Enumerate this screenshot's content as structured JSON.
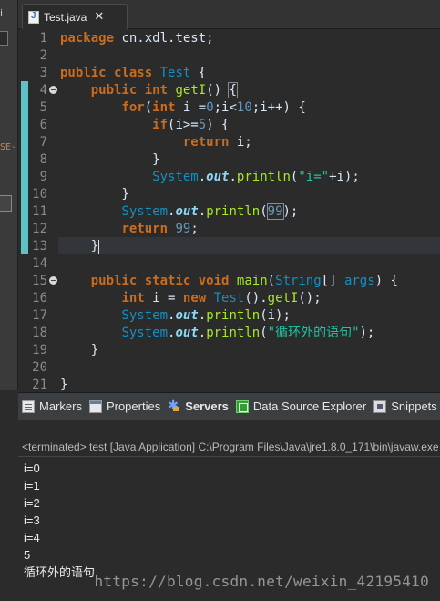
{
  "left_panel": {
    "title_fragment": "i",
    "fragment_text": "SE-"
  },
  "editor_tab": {
    "title": "Test.java",
    "icon": "java-file-icon",
    "close_icon": "close-icon"
  },
  "editor": {
    "line_numbers": [
      "1",
      "2",
      "3",
      "4",
      "5",
      "6",
      "7",
      "8",
      "9",
      "10",
      "11",
      "12",
      "13",
      "14",
      "15",
      "16",
      "17",
      "18",
      "19",
      "20",
      "21"
    ],
    "lines": [
      [
        {
          "t": "package",
          "c": "kw"
        },
        {
          "t": " cn.xdl.test;",
          "c": ""
        }
      ],
      [],
      [
        {
          "t": "public",
          "c": "kw"
        },
        {
          "t": " ",
          "c": ""
        },
        {
          "t": "class",
          "c": "kw"
        },
        {
          "t": " ",
          "c": ""
        },
        {
          "t": "Test",
          "c": "ty"
        },
        {
          "t": " {",
          "c": ""
        }
      ],
      [
        {
          "t": "    ",
          "c": ""
        },
        {
          "t": "public",
          "c": "kw"
        },
        {
          "t": " ",
          "c": ""
        },
        {
          "t": "int",
          "c": "kw"
        },
        {
          "t": " ",
          "c": ""
        },
        {
          "t": "getI",
          "c": "mt"
        },
        {
          "t": "() ",
          "c": ""
        },
        {
          "t": "{",
          "c": "brace-sel"
        }
      ],
      [
        {
          "t": "        ",
          "c": ""
        },
        {
          "t": "for",
          "c": "kw"
        },
        {
          "t": "(",
          "c": ""
        },
        {
          "t": "int",
          "c": "kw"
        },
        {
          "t": " i =",
          "c": ""
        },
        {
          "t": "0",
          "c": "nm"
        },
        {
          "t": ";i<",
          "c": ""
        },
        {
          "t": "10",
          "c": "nm"
        },
        {
          "t": ";i++) {",
          "c": ""
        }
      ],
      [
        {
          "t": "            ",
          "c": ""
        },
        {
          "t": "if",
          "c": "kw"
        },
        {
          "t": "(i>=",
          "c": ""
        },
        {
          "t": "5",
          "c": "nm"
        },
        {
          "t": ") {",
          "c": ""
        }
      ],
      [
        {
          "t": "                ",
          "c": ""
        },
        {
          "t": "return",
          "c": "kw"
        },
        {
          "t": " i;",
          "c": ""
        }
      ],
      [
        {
          "t": "            }",
          "c": ""
        }
      ],
      [
        {
          "t": "            ",
          "c": ""
        },
        {
          "t": "System",
          "c": "ty"
        },
        {
          "t": ".",
          "c": ""
        },
        {
          "t": "out",
          "c": "fl"
        },
        {
          "t": ".",
          "c": ""
        },
        {
          "t": "println",
          "c": "mt"
        },
        {
          "t": "(",
          "c": ""
        },
        {
          "t": "\"i=\"",
          "c": "st"
        },
        {
          "t": "+i);",
          "c": ""
        }
      ],
      [
        {
          "t": "        }",
          "c": ""
        }
      ],
      [
        {
          "t": "        ",
          "c": ""
        },
        {
          "t": "System",
          "c": "ty"
        },
        {
          "t": ".",
          "c": ""
        },
        {
          "t": "out",
          "c": "fl"
        },
        {
          "t": ".",
          "c": ""
        },
        {
          "t": "println",
          "c": "mt"
        },
        {
          "t": "(",
          "c": ""
        },
        {
          "t": "99",
          "c": "nm box99"
        },
        {
          "t": ");",
          "c": ""
        }
      ],
      [
        {
          "t": "        ",
          "c": ""
        },
        {
          "t": "return",
          "c": "kw"
        },
        {
          "t": " ",
          "c": ""
        },
        {
          "t": "99",
          "c": "nm"
        },
        {
          "t": ";",
          "c": ""
        }
      ],
      [
        {
          "t": "    }",
          "c": ""
        },
        {
          "t": "",
          "c": "caret"
        }
      ],
      [],
      [
        {
          "t": "    ",
          "c": ""
        },
        {
          "t": "public",
          "c": "kw"
        },
        {
          "t": " ",
          "c": ""
        },
        {
          "t": "static",
          "c": "kw"
        },
        {
          "t": " ",
          "c": ""
        },
        {
          "t": "void",
          "c": "kw"
        },
        {
          "t": " ",
          "c": ""
        },
        {
          "t": "main",
          "c": "mt"
        },
        {
          "t": "(",
          "c": ""
        },
        {
          "t": "String",
          "c": "ty"
        },
        {
          "t": "[] ",
          "c": ""
        },
        {
          "t": "args",
          "c": "ty"
        },
        {
          "t": ") {",
          "c": ""
        }
      ],
      [
        {
          "t": "        ",
          "c": ""
        },
        {
          "t": "int",
          "c": "kw"
        },
        {
          "t": " i = ",
          "c": ""
        },
        {
          "t": "new",
          "c": "kw"
        },
        {
          "t": " ",
          "c": ""
        },
        {
          "t": "Test",
          "c": "ty"
        },
        {
          "t": "().",
          "c": ""
        },
        {
          "t": "getI",
          "c": "mt"
        },
        {
          "t": "();",
          "c": ""
        }
      ],
      [
        {
          "t": "        ",
          "c": ""
        },
        {
          "t": "System",
          "c": "ty"
        },
        {
          "t": ".",
          "c": ""
        },
        {
          "t": "out",
          "c": "fl"
        },
        {
          "t": ".",
          "c": ""
        },
        {
          "t": "println",
          "c": "mt"
        },
        {
          "t": "(i);",
          "c": ""
        }
      ],
      [
        {
          "t": "        ",
          "c": ""
        },
        {
          "t": "System",
          "c": "ty"
        },
        {
          "t": ".",
          "c": ""
        },
        {
          "t": "out",
          "c": "fl"
        },
        {
          "t": ".",
          "c": ""
        },
        {
          "t": "println",
          "c": "mt"
        },
        {
          "t": "(",
          "c": ""
        },
        {
          "t": "\"循环外的语句\"",
          "c": "st"
        },
        {
          "t": ");",
          "c": ""
        }
      ],
      [
        {
          "t": "    }",
          "c": ""
        }
      ],
      [],
      [
        {
          "t": "}",
          "c": ""
        }
      ]
    ]
  },
  "views": {
    "tabs": [
      {
        "label": "Markers",
        "icon": "markers-icon"
      },
      {
        "label": "Properties",
        "icon": "properties-icon"
      },
      {
        "label": "Servers",
        "icon": "servers-icon"
      },
      {
        "label": "Data Source Explorer",
        "icon": "data-source-icon"
      },
      {
        "label": "Snippets",
        "icon": "snippets-icon"
      }
    ]
  },
  "console": {
    "status": "<terminated> test [Java Application] C:\\Program Files\\Java\\jre1.8.0_171\\bin\\javaw.exe",
    "output": [
      "i=0",
      "i=1",
      "i=2",
      "i=3",
      "i=4",
      "5",
      "循环外的语句"
    ]
  },
  "watermark": "https://blog.csdn.net/weixin_42195410",
  "colors": {
    "keyword": "#cc6c1d",
    "type": "#1290c3",
    "method": "#a7ec21",
    "string": "#17c6a3",
    "field": "#8ddaf8",
    "number": "#6897bb",
    "change_marker": "#5dc2c6"
  }
}
